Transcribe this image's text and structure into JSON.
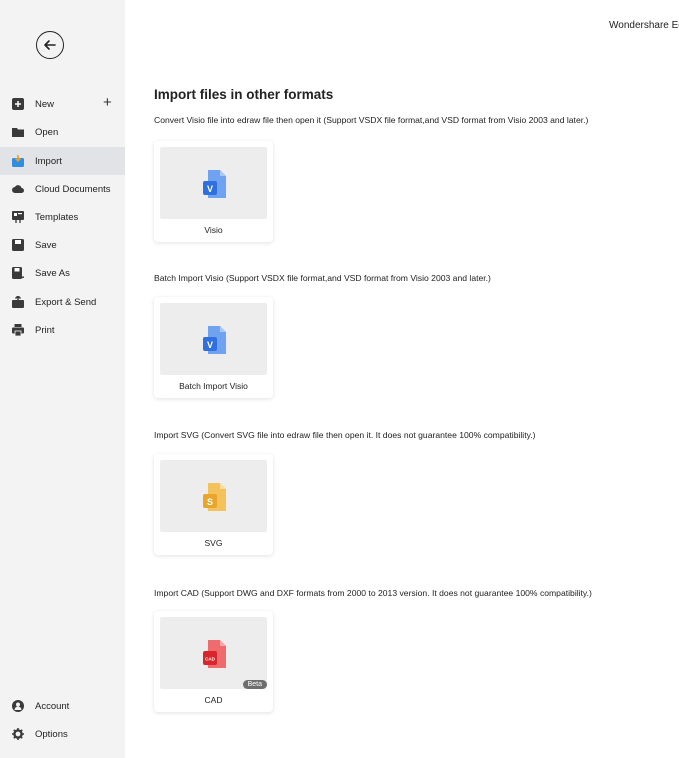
{
  "app_title": "Wondershare Ec",
  "sidebar": {
    "items": [
      {
        "label": "New",
        "icon": "new-icon"
      },
      {
        "label": "Open",
        "icon": "folder-icon"
      },
      {
        "label": "Import",
        "icon": "import-icon"
      },
      {
        "label": "Cloud Documents",
        "icon": "cloud-icon"
      },
      {
        "label": "Templates",
        "icon": "templates-icon"
      },
      {
        "label": "Save",
        "icon": "save-icon"
      },
      {
        "label": "Save As",
        "icon": "save-as-icon"
      },
      {
        "label": "Export & Send",
        "icon": "export-icon"
      },
      {
        "label": "Print",
        "icon": "print-icon"
      }
    ],
    "new_plus": "+",
    "bottom": [
      {
        "label": "Account",
        "icon": "account-icon"
      },
      {
        "label": "Options",
        "icon": "gear-icon"
      }
    ]
  },
  "main": {
    "title": "Import files in other formats",
    "sections": [
      {
        "description": "Convert Visio file into edraw file then open it (Support VSDX file format,and VSD format from Visio 2003 and later.)",
        "card_label": "Visio",
        "icon_letter": "V"
      },
      {
        "description": "Batch Import Visio (Support VSDX file format,and VSD format from Visio 2003 and later.)",
        "card_label": "Batch Import Visio",
        "icon_letter": "V"
      },
      {
        "description": "Import SVG (Convert SVG file into edraw file then open it. It does not guarantee 100% compatibility.)",
        "card_label": "SVG",
        "icon_letter": "S"
      },
      {
        "description": "Import CAD (Support DWG and DXF formats from 2000 to 2013 version. It does not guarantee 100% compatibility.)",
        "card_label": "CAD",
        "icon_letter": "CAD",
        "badge": "Beta"
      }
    ]
  },
  "colors": {
    "visio": "#2f6fe0",
    "svg": "#e9a62b",
    "cad": "#e0393e",
    "active_bg": "#e2e3e6"
  }
}
